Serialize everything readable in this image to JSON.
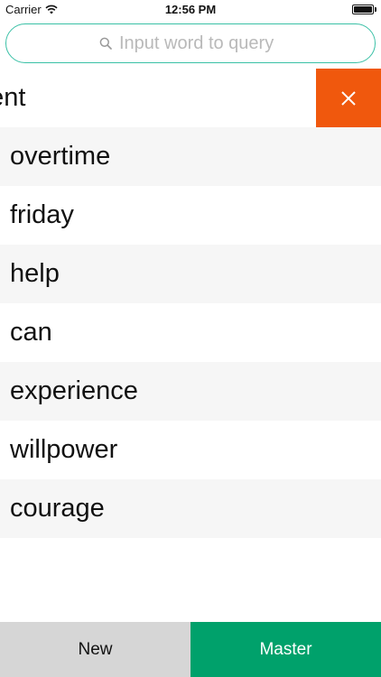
{
  "status_bar": {
    "carrier": "Carrier",
    "time": "12:56 PM"
  },
  "search": {
    "placeholder": "Input word to query",
    "icon": "search-icon"
  },
  "colors": {
    "accent": "#3ac0a6",
    "delete": "#f0580d",
    "master_tab": "#00a16b",
    "new_tab": "#d6d6d6",
    "row_alt": "#f6f6f6"
  },
  "words": [
    {
      "text": "nent"
    },
    {
      "text": "overtime"
    },
    {
      "text": "friday"
    },
    {
      "text": "help"
    },
    {
      "text": "can"
    },
    {
      "text": "experience"
    },
    {
      "text": "willpower"
    },
    {
      "text": "courage"
    }
  ],
  "tabs": {
    "new": "New",
    "master": "Master"
  }
}
